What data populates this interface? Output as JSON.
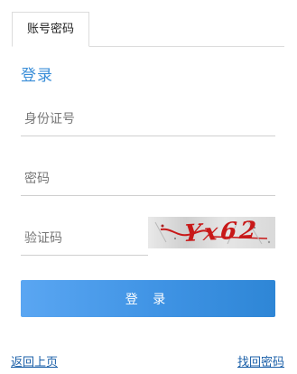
{
  "tabs": [
    {
      "label": "账号密码"
    }
  ],
  "heading": "登录",
  "form": {
    "id_placeholder": "身份证号",
    "password_placeholder": "密码",
    "code_placeholder": "验证码",
    "captcha_text": "Yx62"
  },
  "login_button": "登 录",
  "links": {
    "back": "返回上页",
    "recover_password": "找回密码"
  },
  "colors": {
    "accent": "#3a8ed8",
    "button_start": "#5aa6f2",
    "button_end": "#2e86d6",
    "link": "#1a5fa8",
    "captcha_ink": "#c81818"
  }
}
